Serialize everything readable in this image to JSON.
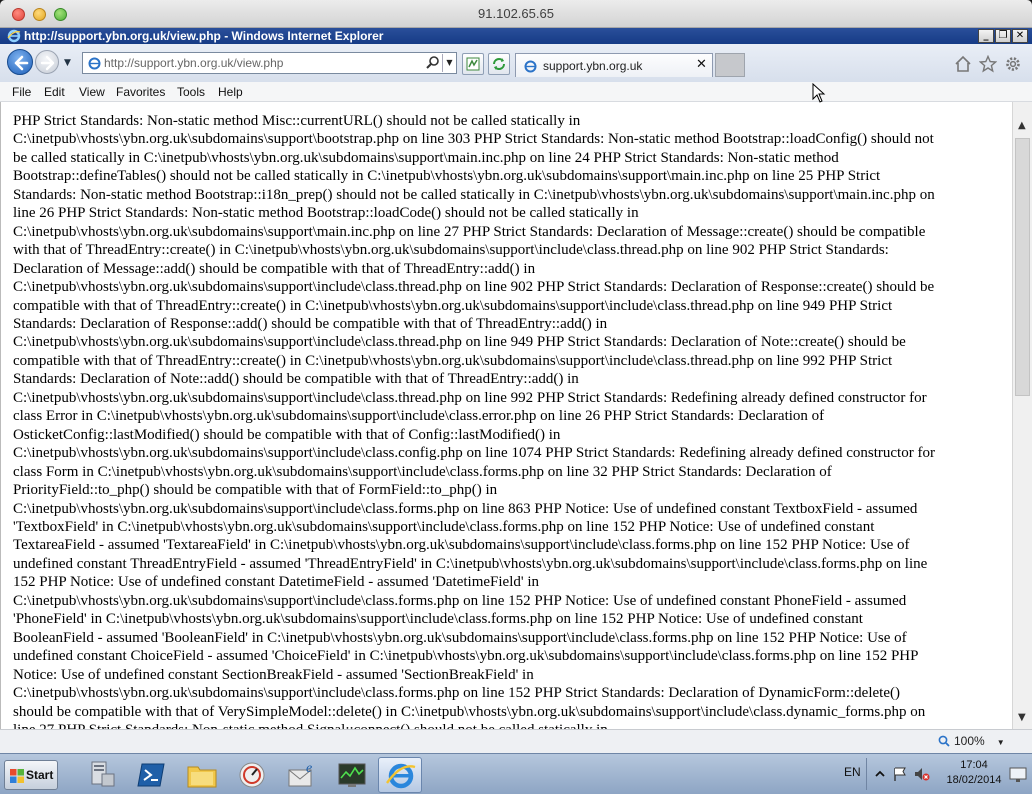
{
  "remote_window": {
    "title": "91.102.65.65"
  },
  "browser": {
    "title": "http://support.ybn.org.uk/view.php - Windows Internet Explorer",
    "address": "http://support.ybn.org.uk/view.php",
    "tab_label": "support.ybn.org.uk",
    "menu": [
      "File",
      "Edit",
      "View",
      "Favorites",
      "Tools",
      "Help"
    ],
    "zoom": "100%"
  },
  "page": {
    "error_text": "PHP Strict Standards: Non-static method Misc::currentURL() should not be called statically in\nC:\\inetpub\\vhosts\\ybn.org.uk\\subdomains\\support\\bootstrap.php on line 303 PHP Strict Standards: Non-static method Bootstrap::loadConfig() should not\nbe called statically in C:\\inetpub\\vhosts\\ybn.org.uk\\subdomains\\support\\main.inc.php on line 24 PHP Strict Standards: Non-static method\nBootstrap::defineTables() should not be called statically in C:\\inetpub\\vhosts\\ybn.org.uk\\subdomains\\support\\main.inc.php on line 25 PHP Strict\nStandards: Non-static method Bootstrap::i18n_prep() should not be called statically in C:\\inetpub\\vhosts\\ybn.org.uk\\subdomains\\support\\main.inc.php on\nline 26 PHP Strict Standards: Non-static method Bootstrap::loadCode() should not be called statically in\nC:\\inetpub\\vhosts\\ybn.org.uk\\subdomains\\support\\main.inc.php on line 27 PHP Strict Standards: Declaration of Message::create() should be compatible\nwith that of ThreadEntry::create() in C:\\inetpub\\vhosts\\ybn.org.uk\\subdomains\\support\\include\\class.thread.php on line 902 PHP Strict Standards:\nDeclaration of Message::add() should be compatible with that of ThreadEntry::add() in\nC:\\inetpub\\vhosts\\ybn.org.uk\\subdomains\\support\\include\\class.thread.php on line 902 PHP Strict Standards: Declaration of Response::create() should be\ncompatible with that of ThreadEntry::create() in C:\\inetpub\\vhosts\\ybn.org.uk\\subdomains\\support\\include\\class.thread.php on line 949 PHP Strict\nStandards: Declaration of Response::add() should be compatible with that of ThreadEntry::add() in\nC:\\inetpub\\vhosts\\ybn.org.uk\\subdomains\\support\\include\\class.thread.php on line 949 PHP Strict Standards: Declaration of Note::create() should be\ncompatible with that of ThreadEntry::create() in C:\\inetpub\\vhosts\\ybn.org.uk\\subdomains\\support\\include\\class.thread.php on line 992 PHP Strict\nStandards: Declaration of Note::add() should be compatible with that of ThreadEntry::add() in\nC:\\inetpub\\vhosts\\ybn.org.uk\\subdomains\\support\\include\\class.thread.php on line 992 PHP Strict Standards: Redefining already defined constructor for\nclass Error in C:\\inetpub\\vhosts\\ybn.org.uk\\subdomains\\support\\include\\class.error.php on line 26 PHP Strict Standards: Declaration of\nOsticketConfig::lastModified() should be compatible with that of Config::lastModified() in\nC:\\inetpub\\vhosts\\ybn.org.uk\\subdomains\\support\\include\\class.config.php on line 1074 PHP Strict Standards: Redefining already defined constructor for\nclass Form in C:\\inetpub\\vhosts\\ybn.org.uk\\subdomains\\support\\include\\class.forms.php on line 32 PHP Strict Standards: Declaration of\nPriorityField::to_php() should be compatible with that of FormField::to_php() in\nC:\\inetpub\\vhosts\\ybn.org.uk\\subdomains\\support\\include\\class.forms.php on line 863 PHP Notice: Use of undefined constant TextboxField - assumed\n'TextboxField' in C:\\inetpub\\vhosts\\ybn.org.uk\\subdomains\\support\\include\\class.forms.php on line 152 PHP Notice: Use of undefined constant\nTextareaField - assumed 'TextareaField' in C:\\inetpub\\vhosts\\ybn.org.uk\\subdomains\\support\\include\\class.forms.php on line 152 PHP Notice: Use of\nundefined constant ThreadEntryField - assumed 'ThreadEntryField' in C:\\inetpub\\vhosts\\ybn.org.uk\\subdomains\\support\\include\\class.forms.php on line\n152 PHP Notice: Use of undefined constant DatetimeField - assumed 'DatetimeField' in\nC:\\inetpub\\vhosts\\ybn.org.uk\\subdomains\\support\\include\\class.forms.php on line 152 PHP Notice: Use of undefined constant PhoneField - assumed\n'PhoneField' in C:\\inetpub\\vhosts\\ybn.org.uk\\subdomains\\support\\include\\class.forms.php on line 152 PHP Notice: Use of undefined constant\nBooleanField - assumed 'BooleanField' in C:\\inetpub\\vhosts\\ybn.org.uk\\subdomains\\support\\include\\class.forms.php on line 152 PHP Notice: Use of\nundefined constant ChoiceField - assumed 'ChoiceField' in C:\\inetpub\\vhosts\\ybn.org.uk\\subdomains\\support\\include\\class.forms.php on line 152 PHP\nNotice: Use of undefined constant SectionBreakField - assumed 'SectionBreakField' in\nC:\\inetpub\\vhosts\\ybn.org.uk\\subdomains\\support\\include\\class.forms.php on line 152 PHP Strict Standards: Declaration of DynamicForm::delete()\nshould be compatible with that of VerySimpleModel::delete() in C:\\inetpub\\vhosts\\ybn.org.uk\\subdomains\\support\\include\\class.dynamic_forms.php on\nline 27 PHP Strict Standards: Non-static method Signal::connect() should not be called statically in"
  },
  "taskbar": {
    "start_label": "Start",
    "language": "EN",
    "time": "17:04",
    "date": "18/02/2014",
    "apps": [
      "server-manager-icon",
      "powershell-icon",
      "file-explorer-icon",
      "process-monitor-icon",
      "email-icon",
      "network-monitor-icon",
      "internet-explorer-icon"
    ]
  },
  "colors": {
    "ie_caption": "#1d438f",
    "taskbar": "#9fb3cf",
    "ie_blue": "#1d5fb8"
  }
}
